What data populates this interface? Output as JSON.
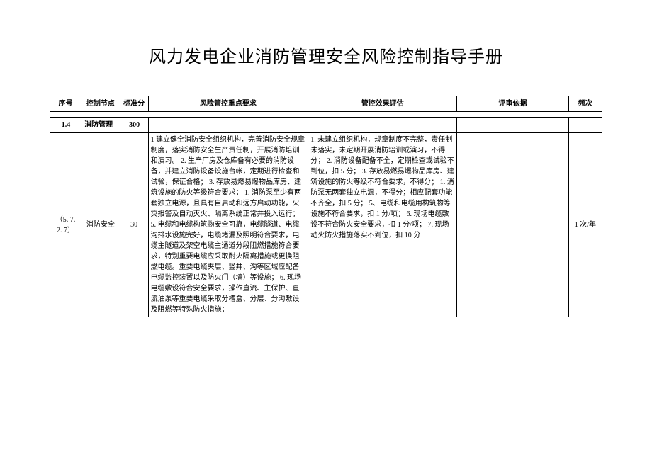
{
  "title": "风力发电企业消防管理安全风险控制指导手册",
  "headers": {
    "idx": "序号",
    "node": "控制节点",
    "score": "标准分",
    "req": "风险管控重点要求",
    "eval": "管控效果评估",
    "basis": "评审依据",
    "freq": "频次"
  },
  "section": {
    "idx": "1.4",
    "node": "消防管理",
    "score": "300"
  },
  "row": {
    "idx": "（5. 7. 2. 7）",
    "node": "消防安全",
    "score": "30",
    "req": "1 建立健全消防安全组织机构，完善消防安全规章制度，落实消防安全生产责任制，开展消防培训和演习。\n2. 生产厂房及仓库备有必要的消防设备，并建立消防设备设施台帐，定期进行检查和试验，保证合格；\n3. 存放易燃易爆物品库房、建筑设施的防火等级符合要求；\n1. 消防泵至少有两套独立电源，且具有自启动和远方启动功能，火灾报警及自动灭火、隔离系统正常并投入运行；\n5. 电缆和电缆构筑物安全可靠，电缆隧道、电缆沟排水设施完好，电缆堵漏及照明符合要求，电缆主隧道及架空电缆主通道分段阻燃措施符合要求，特别重要电缆应采取耐火隔离措施或更换阻燃电缆。重要电缆夹层、竖井、沟等区域应配备电缆监控装置以及防火门（墙）等设施；\n6. 现场电缆敷设符合安全要求，操作直流、主保护、直流油泵等重要电缆采取分槽盒、分层、分沟敷设及阻燃等特殊防火措施；",
    "eval": "1. 未建立组织机构，规章制度不完整，责任制未落实，未定期开展消防培训或演习，不得分；\n2. 消防设备配备不全，定期检查或试验不到位，扣 5 分；\n3. 存放易燃易爆物品库房、建筑设施的防火等级不符合要求，不得分；\n1. 消防泵无两套独立电源，不得分；相应配套功能不齐全，扣 5 分；\n5、电缆和电缆用构筑物等设施不符合要求，扣 1 分/项；\n6. 现场电缆敷设不符合防火安全要求，扣 1 分/项；\n7. 现场动火防火措施落实不到位，扣 10 分",
    "basis": "",
    "freq": "1 次/年"
  }
}
